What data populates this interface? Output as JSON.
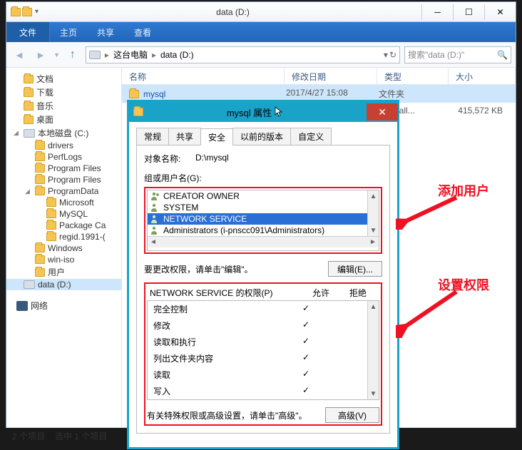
{
  "window": {
    "title": "data (D:)",
    "minimize": "─",
    "maximize": "☐",
    "close": "✕"
  },
  "menu": {
    "file": "文件",
    "home": "主页",
    "share": "共享",
    "view": "查看"
  },
  "address": {
    "root": "这台电脑",
    "current": "data (D:)",
    "refresh": "↻",
    "dropdown": "▾"
  },
  "search": {
    "placeholder": "搜索\"data (D:)\""
  },
  "columns": {
    "name": "名称",
    "date": "修改日期",
    "type": "类型",
    "size": "大小"
  },
  "files": [
    {
      "name": "mysql",
      "date": "2017/4/27 15:08",
      "type": "文件夹",
      "size": ""
    },
    {
      "name": "",
      "date": "",
      "type": "s Install...",
      "size": "415,572 KB"
    }
  ],
  "tree": {
    "docs": "文档",
    "downloads": "下载",
    "music": "音乐",
    "desktop": "桌面",
    "localc": "本地磁盘 (C:)",
    "drivers": "drivers",
    "perflogs": "PerfLogs",
    "pf": "Program Files",
    "pf86": "Program Files",
    "programdata": "ProgramData",
    "microsoft": "Microsoft",
    "mysql": "MySQL",
    "packagecache": "Package Ca",
    "regid": "regid.1991-(",
    "windows": "Windows",
    "winiso": "win-iso",
    "users": "用户",
    "datad": "data (D:)",
    "network": "网络"
  },
  "status": {
    "items": "2 个项目",
    "selected": "选中 1 个项目"
  },
  "dialog": {
    "title": "mysql 属性",
    "close": "✕",
    "tabs": {
      "general": "常规",
      "share": "共享",
      "security": "安全",
      "prev": "以前的版本",
      "custom": "自定义"
    },
    "object_label": "对象名称:",
    "object_value": "D:\\mysql",
    "groups_label": "组或用户名(G):",
    "groups": [
      "CREATOR OWNER",
      "SYSTEM",
      "NETWORK SERVICE",
      "Administrators (i-pnscc091\\Administrators)"
    ],
    "edit_hint": "要更改权限，请单击\"编辑\"。",
    "edit_btn": "编辑(E)...",
    "perm_header": "NETWORK SERVICE 的权限(P)",
    "perm_allow": "允许",
    "perm_deny": "拒绝",
    "perms": [
      {
        "name": "完全控制",
        "allow": "✓",
        "deny": ""
      },
      {
        "name": "修改",
        "allow": "✓",
        "deny": ""
      },
      {
        "name": "读取和执行",
        "allow": "✓",
        "deny": ""
      },
      {
        "name": "列出文件夹内容",
        "allow": "✓",
        "deny": ""
      },
      {
        "name": "读取",
        "allow": "✓",
        "deny": ""
      },
      {
        "name": "写入",
        "allow": "✓",
        "deny": ""
      }
    ],
    "adv_hint": "有关特殊权限或高级设置，请单击\"高级\"。",
    "adv_btn": "高级(V)"
  },
  "annotations": {
    "add_user": "添加用户",
    "set_perm": "设置权限"
  }
}
